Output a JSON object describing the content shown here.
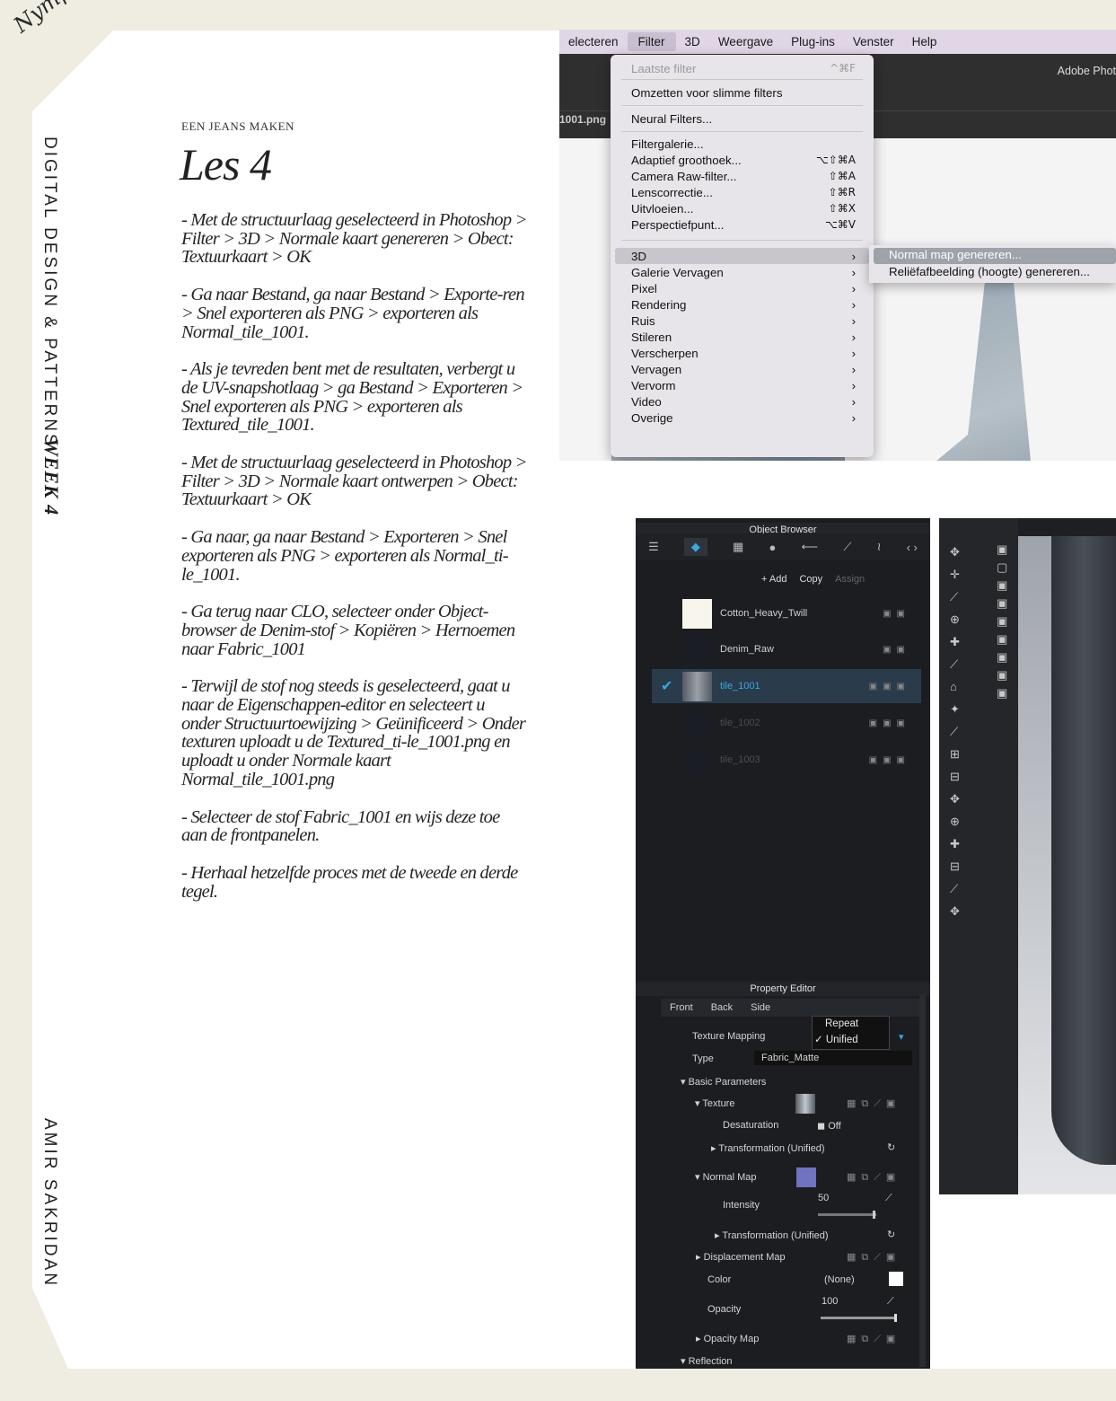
{
  "sidebar": {
    "logo": "Nymphea",
    "course": "DIGITAL DESIGN & PATTERNS",
    "week": "WEEK 4",
    "author": "AMIR SAKRIDAN"
  },
  "lesson": {
    "kicker": "EEN JEANS MAKEN",
    "title": "Les 4",
    "steps": [
      "- Met de structuurlaag geselecteerd in Photoshop > Filter > 3D > Normale kaart genereren > Obect: Textuurkaart > OK",
      "- Ga naar Bestand, ga naar Bestand > Exporte-ren > Snel exporteren als PNG > exporteren als Normal_tile_1001.",
      "- Als je tevreden bent met de resultaten, verbergt u de UV-snapshotlaag > ga Bestand > Exporteren > Snel exporteren als PNG > exporteren als Textured_tile_1001.",
      "- Met de structuurlaag geselecteerd in Photoshop > Filter > 3D > Normale kaart ontwerpen > Obect: Textuurkaart > OK",
      "- Ga naar, ga naar Bestand > Exporteren > Snel exporteren als PNG > exporteren als Normal_ti-le_1001.",
      "- Ga terug naar CLO, selecteer onder Object-browser de Denim-stof > Kopiëren > Hernoemen naar Fabric_1001",
      "- Terwijl de stof nog steeds is geselecteerd, gaat u naar de Eigenschappen-editor en selecteert u onder Structuurtoewijzing > Geünificeerd > Onder texturen uploadt u de Textured_ti-le_1001.png en uploadt u onder Normale kaart Normal_tile_1001.png",
      "- Selecteer de stof Fabric_1001 en wijs deze toe aan de frontpanelen.",
      "- Herhaal hetzelfde proces met de tweede en derde tegel."
    ]
  },
  "photoshop": {
    "menubar": [
      "electeren",
      "Filter",
      "3D",
      "Weergave",
      "Plug-ins",
      "Venster",
      "Help"
    ],
    "app_title": "Adobe Phot",
    "doc_tab": "1001.png",
    "filter_menu": {
      "last_filter": {
        "label": "Laatste filter",
        "shortcut": "^⌘F"
      },
      "smart": "Omzetten voor slimme filters",
      "neural": "Neural Filters...",
      "items": [
        {
          "label": "Filtergalerie...",
          "shortcut": ""
        },
        {
          "label": "Adaptief groothoek...",
          "shortcut": "⌥⇧⌘A"
        },
        {
          "label": "Camera Raw-filter...",
          "shortcut": "⇧⌘A"
        },
        {
          "label": "Lenscorrectie...",
          "shortcut": "⇧⌘R"
        },
        {
          "label": "Uitvloeien...",
          "shortcut": "⇧⌘X"
        },
        {
          "label": "Perspectiefpunt...",
          "shortcut": "⌥⌘V"
        }
      ],
      "submenus": [
        "3D",
        "Galerie Vervagen",
        "Pixel",
        "Rendering",
        "Ruis",
        "Stileren",
        "Verscherpen",
        "Vervagen",
        "Vervorm",
        "Video",
        "Overige"
      ]
    },
    "submenu_3d": [
      "Normal map genereren...",
      "Reliëfafbeelding (hoogte) genereren..."
    ]
  },
  "clo": {
    "object_browser": {
      "title": "Object Browser",
      "add": "+ Add",
      "copy": "Copy",
      "assign": "Assign",
      "fabrics": [
        {
          "name": "Cotton_Heavy_Twill",
          "color": "#f7f5ec",
          "dim": false
        },
        {
          "name": "Denim_Raw",
          "color": "#1a1e24",
          "dim": false
        },
        {
          "name": "tile_1001",
          "color": "#6c7179",
          "dim": false,
          "selected": true
        },
        {
          "name": "tile_1002",
          "color": "#1a1e24",
          "dim": true
        },
        {
          "name": "tile_1003",
          "color": "#1a1e24",
          "dim": true
        }
      ]
    },
    "property_editor": {
      "title": "Property Editor",
      "tabs": [
        "Front",
        "Back",
        "Side"
      ],
      "texture_mapping_label": "Texture Mapping",
      "mapping_options": [
        "Repeat",
        "Unified"
      ],
      "mapping_selected": "Unified",
      "type_label": "Type",
      "type_value": "Fabric_Matte",
      "basic_parameters": "Basic Parameters",
      "texture": "Texture",
      "desaturation": "Desaturation",
      "desaturation_value": "Off",
      "transformation": "Transformation (Unified)",
      "normal_map": "Normal Map",
      "normal_map_color": "#6f73c0",
      "intensity": "Intensity",
      "intensity_value": "50",
      "displacement_map": "Displacement Map",
      "color": "Color",
      "color_value": "(None)",
      "opacity": "Opacity",
      "opacity_value": "100",
      "opacity_map": "Opacity Map",
      "reflection": "Reflection"
    }
  }
}
